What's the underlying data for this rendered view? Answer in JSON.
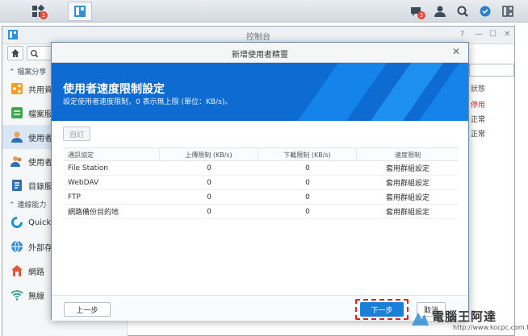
{
  "taskbar": {
    "apps_badge": "1",
    "notifications_badge": "3"
  },
  "control_panel": {
    "title": "控制台",
    "sections": [
      "檔案分享",
      "連線能力"
    ],
    "items": [
      "共用資",
      "檔案服",
      "使用者",
      "使用者",
      "目錄服",
      "QuickC",
      "外部存",
      "網路",
      "無線"
    ],
    "right_fragments": [
      "狀態",
      "停用",
      "正常",
      "正常"
    ]
  },
  "wizard": {
    "title": "新增使用者精靈",
    "heading": "使用者速度限制設定",
    "subheading": "設定使用者速度限制，0 表示無上限 (單位：KB/s)。",
    "edit_label": "自訂",
    "columns": [
      "通訊協定",
      "上傳限制 (KB/s)",
      "下載限制 (KB/s)",
      "速度限制"
    ],
    "rows": [
      [
        "File Station",
        "0",
        "0",
        "套用群組設定"
      ],
      [
        "WebDAV",
        "0",
        "0",
        "套用群組設定"
      ],
      [
        "FTP",
        "0",
        "0",
        "套用群組設定"
      ],
      [
        "網路備份目的地",
        "0",
        "0",
        "套用群組設定"
      ]
    ],
    "prev_label": "上一步",
    "next_label": "下一步",
    "cancel_label": "取消"
  },
  "watermark": {
    "title": "電腦王阿達",
    "url": "http://www.kocpc.com.tw"
  },
  "colors": {
    "accent_blue": "#0e6bd2",
    "highlight_red": "#e0201a"
  }
}
